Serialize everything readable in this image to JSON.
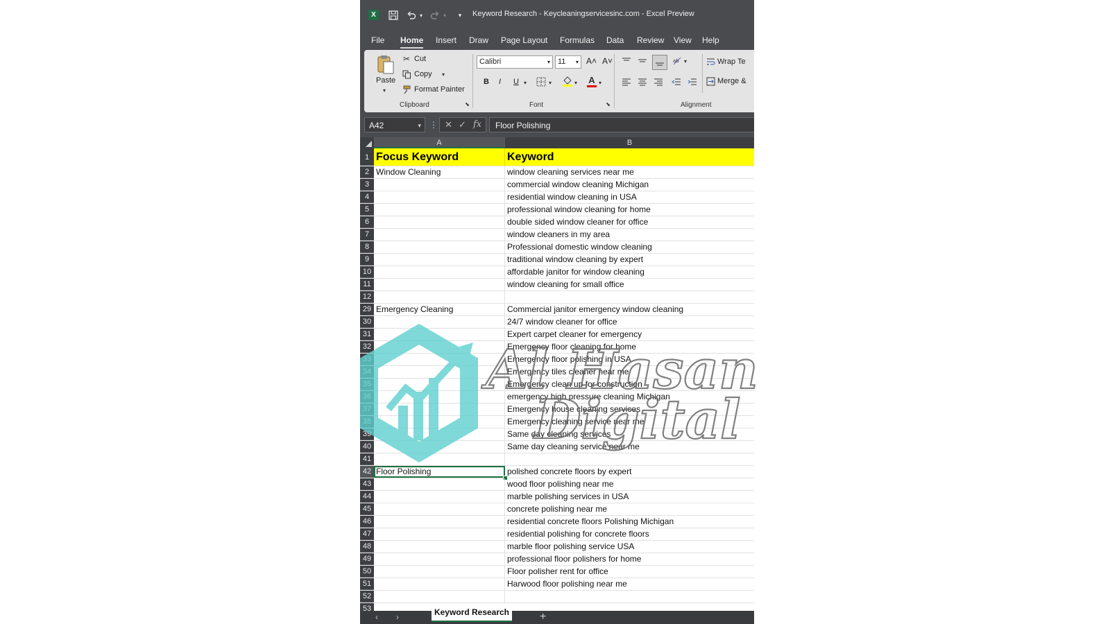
{
  "window": {
    "title": "Keyword Research -  Keycleaningservicesinc.com  -  Excel Preview",
    "app_icon": "X",
    "icons": [
      "excel-logo-icon",
      "save-icon",
      "undo-icon",
      "redo-icon",
      "customize-icon"
    ]
  },
  "menu": {
    "items": [
      "File",
      "Home",
      "Insert",
      "Draw",
      "Page Layout",
      "Formulas",
      "Data",
      "Review",
      "View",
      "Help"
    ],
    "active": "Home"
  },
  "ribbon": {
    "clipboard": {
      "paste": "Paste",
      "cut": "Cut",
      "copy": "Copy",
      "format_painter": "Format Painter",
      "label": "Clipboard"
    },
    "font": {
      "font_name": "Calibri",
      "font_size": "11",
      "bold": "B",
      "italic": "I",
      "underline": "U",
      "grow": "A˄",
      "shrink": "A˅",
      "font_color_letter": "A",
      "label": "Font",
      "fill_color": "#ffff00",
      "font_color": "#e00000"
    },
    "alignment": {
      "wrap": "Wrap Te",
      "merge": "Merge &",
      "label": "Alignment"
    }
  },
  "formula_bar": {
    "name_box": "A42",
    "fx": "fx",
    "content": "Floor Polishing"
  },
  "columns": [
    "A",
    "B"
  ],
  "header_row": {
    "number": "1",
    "a": "Focus Keyword",
    "b": "Keyword",
    "fill": "#ffff00"
  },
  "rows": [
    {
      "n": "2",
      "a": "Window Cleaning",
      "b": "window cleaning services near me"
    },
    {
      "n": "3",
      "a": "",
      "b": "commercial window cleaning Michigan"
    },
    {
      "n": "4",
      "a": "",
      "b": "residential window cleaning in USA"
    },
    {
      "n": "5",
      "a": "",
      "b": "professional window cleaning for home"
    },
    {
      "n": "6",
      "a": "",
      "b": "double sided window cleaner for office"
    },
    {
      "n": "7",
      "a": "",
      "b": "window cleaners in my area"
    },
    {
      "n": "8",
      "a": "",
      "b": "Professional domestic window cleaning"
    },
    {
      "n": "9",
      "a": "",
      "b": "traditional window cleaning by expert"
    },
    {
      "n": "10",
      "a": "",
      "b": "affordable janitor for window cleaning"
    },
    {
      "n": "11",
      "a": "",
      "b": "window cleaning for small office"
    },
    {
      "n": "12",
      "a": "",
      "b": ""
    },
    {
      "n": "29",
      "a": "Emergency Cleaning",
      "b": "Commercial janitor emergency  window cleaning"
    },
    {
      "n": "30",
      "a": "",
      "b": "24/7 window cleaner for office"
    },
    {
      "n": "31",
      "a": "",
      "b": "Expert carpet cleaner for emergency"
    },
    {
      "n": "32",
      "a": "",
      "b": "Emergency floor cleaning for home"
    },
    {
      "n": "33",
      "a": "",
      "b": "Emergency floor polishing in USA"
    },
    {
      "n": "34",
      "a": "",
      "b": "Emergency tiles cleaner near me"
    },
    {
      "n": "35",
      "a": "",
      "b": "Emergency clean up for construction"
    },
    {
      "n": "36",
      "a": "",
      "b": "emergency high pressure cleaning Michigan"
    },
    {
      "n": "37",
      "a": "",
      "b": "Emergency house cleaning services"
    },
    {
      "n": "38",
      "a": "",
      "b": "Emergency cleaning service near me"
    },
    {
      "n": "39",
      "a": "",
      "b": "Same day cleaning services"
    },
    {
      "n": "40",
      "a": "",
      "b": "Same day cleaning service near me"
    },
    {
      "n": "41",
      "a": "",
      "b": ""
    },
    {
      "n": "42",
      "a": "Floor Polishing",
      "b": "polished concrete floors by expert",
      "selected": true
    },
    {
      "n": "43",
      "a": "",
      "b": "wood floor polishing near me"
    },
    {
      "n": "44",
      "a": "",
      "b": "marble polishing services in USA"
    },
    {
      "n": "45",
      "a": "",
      "b": "concrete polishing near me"
    },
    {
      "n": "46",
      "a": "",
      "b": "residential concrete floors Polishing Michigan"
    },
    {
      "n": "47",
      "a": "",
      "b": "residential polishing for concrete floors"
    },
    {
      "n": "48",
      "a": "",
      "b": "marble floor polishing service USA"
    },
    {
      "n": "49",
      "a": "",
      "b": "professional floor polishers for home"
    },
    {
      "n": "50",
      "a": "",
      "b": "Floor polisher rent for office"
    },
    {
      "n": "51",
      "a": "",
      "b": "Harwood floor polishing near me"
    },
    {
      "n": "52",
      "a": "",
      "b": ""
    },
    {
      "n": "53",
      "a": "",
      "b": ""
    }
  ],
  "sheet_tabs": {
    "active": "Keyword Research",
    "add": "+",
    "prev": "‹",
    "next": "›"
  },
  "watermark": {
    "line1": "Al Hasan",
    "line2": "Digital",
    "logo_color": "#5fd0cf",
    "text_color": "#6b6b6b"
  }
}
